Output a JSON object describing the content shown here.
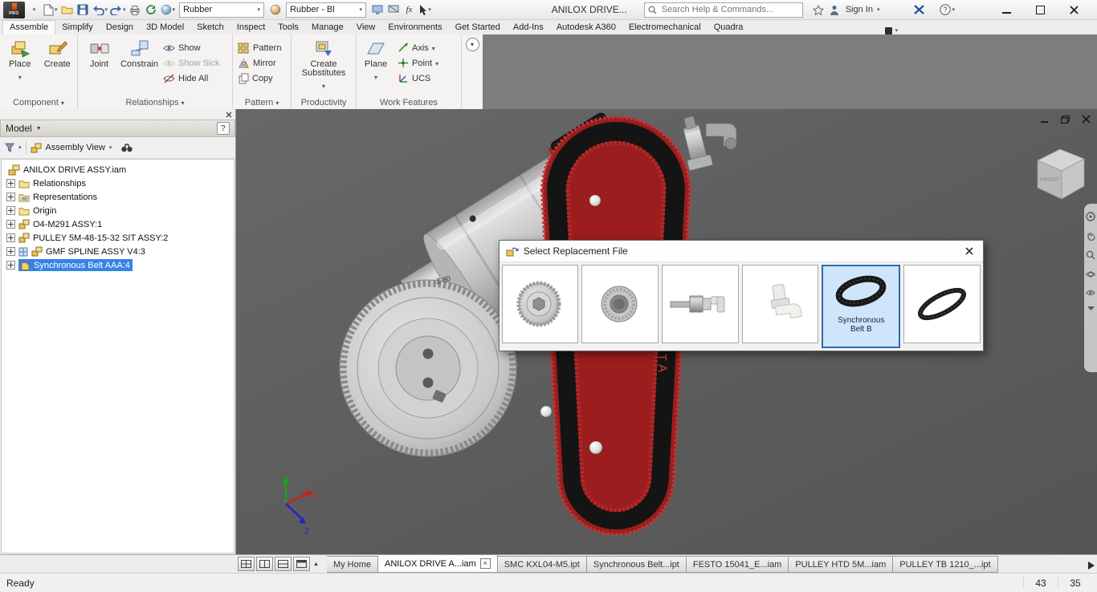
{
  "titlebar": {
    "doc_title": "ANILOX DRIVE...",
    "material_value": "Rubber",
    "appearance_value": "Rubber - Bl",
    "search_placeholder": "Search Help & Commands...",
    "sign_in_label": "Sign In"
  },
  "ribbon": {
    "tabs": [
      {
        "label": "Assemble",
        "active": true
      },
      {
        "label": "Simplify"
      },
      {
        "label": "Design"
      },
      {
        "label": "3D Model"
      },
      {
        "label": "Sketch"
      },
      {
        "label": "Inspect"
      },
      {
        "label": "Tools"
      },
      {
        "label": "Manage"
      },
      {
        "label": "View"
      },
      {
        "label": "Environments"
      },
      {
        "label": "Get Started"
      },
      {
        "label": "Add-Ins"
      },
      {
        "label": "Autodesk A360"
      },
      {
        "label": "Electromechanical"
      },
      {
        "label": "Quadra"
      }
    ],
    "panels": {
      "component": {
        "label": "Component",
        "place": "Place",
        "create": "Create"
      },
      "relationships": {
        "label": "Relationships",
        "joint": "Joint",
        "constrain": "Constrain",
        "show": "Show",
        "show_sick": "Show Sick",
        "hide_all": "Hide All"
      },
      "pattern": {
        "label": "Pattern",
        "pattern": "Pattern",
        "mirror": "Mirror",
        "copy": "Copy"
      },
      "productivity": {
        "label": "Productivity",
        "create_substitutes": "Create Substitutes"
      },
      "work_features": {
        "label": "Work Features",
        "plane": "Plane",
        "axis": "Axis",
        "point": "Point",
        "ucs": "UCS"
      }
    }
  },
  "browser": {
    "panel_title": "Model",
    "view_mode": "Assembly View",
    "tree": [
      {
        "label": "ANILOX DRIVE ASSY.iam",
        "type": "assembly-root"
      },
      {
        "label": "Relationships",
        "type": "folder"
      },
      {
        "label": "Representations",
        "type": "folder"
      },
      {
        "label": "Origin",
        "type": "folder"
      },
      {
        "label": "O4-M291 ASSY:1",
        "type": "assembly"
      },
      {
        "label": "PULLEY 5M-48-15-32 SIT ASSY:2",
        "type": "assembly"
      },
      {
        "label": "GMF SPLINE ASSY V4:3",
        "type": "assembly"
      },
      {
        "label": "Synchronous Belt AAA:4",
        "type": "part",
        "selected": true
      }
    ]
  },
  "viewport": {
    "gear_label": "Z 80",
    "belt_brand": "DELTA",
    "viewcube_front_label": "FRONT",
    "triad": {
      "x_label": "X",
      "z_label": "Z"
    }
  },
  "dialog": {
    "title": "Select Replacement File",
    "thumbnails": [
      {
        "name": "pulley"
      },
      {
        "name": "clamping-bush"
      },
      {
        "name": "shaft-fitting"
      },
      {
        "name": "elbow-fitting"
      },
      {
        "name": "synchronous-belt-b",
        "label": "Synchronous Belt B",
        "selected": true
      },
      {
        "name": "belt"
      }
    ]
  },
  "doctabs": [
    {
      "label": "My Home"
    },
    {
      "label": "ANILOX DRIVE A...iam",
      "active": true,
      "closable": true
    },
    {
      "label": "SMC KXL04-M5.ipt"
    },
    {
      "label": "Synchronous Belt...ipt"
    },
    {
      "label": "FESTO 15041_E...iam"
    },
    {
      "label": "PULLEY HTD 5M...iam"
    },
    {
      "label": "PULLEY TB 1210_...ipt"
    }
  ],
  "statusbar": {
    "message": "Ready",
    "value_1": "43",
    "value_2": "35"
  },
  "colors": {
    "selection_blue": "#3584e4",
    "belt_red": "#b32525",
    "viewport_gray": "#5e5e5e",
    "thumbnail_selected_blue": "#2b6cb5"
  }
}
